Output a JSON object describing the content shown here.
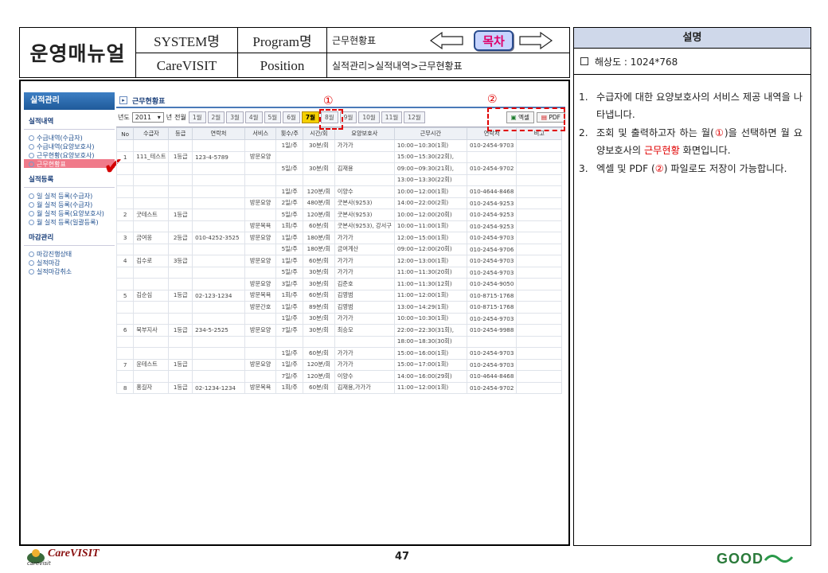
{
  "header": {
    "title": "운영매뉴얼",
    "system_label": "SYSTEM명",
    "system_value": "CareVISIT",
    "program_label": "Program명",
    "program_value": "근무현황표",
    "position_label": "Position",
    "position_value": "실적관리>실적내역>근무현황표",
    "toc_label": "목차"
  },
  "description": {
    "title": "설명",
    "resolution": "해상도 : 1024*768",
    "items": [
      {
        "num": "1.",
        "text": "수급자에 대한 요양보호사의 서비스 제공 내역을 나타냅니다."
      },
      {
        "num": "2.",
        "pre": "조회 및 출력하고자 하는 월(",
        "mark": "①",
        "mid": ")을 선택하면 월 요양보호사의 ",
        "red": "근무현황",
        "post": " 화면입니다."
      },
      {
        "num": "3.",
        "pre": "엑셀 및 PDF (",
        "mark": "②",
        "post": ") 파일로도 저장이 가능합니다."
      }
    ]
  },
  "app": {
    "nav_title": "실적관리",
    "sections": [
      {
        "title": "실적내역",
        "items": [
          "수급내역(수급자)",
          "수급내역(요양보호사)",
          "근무현황(요양보호사)",
          "근무현황표"
        ]
      },
      {
        "title": "실적등록",
        "items": [
          "일 실적 등록(수급자)",
          "월 실적 등록(수급자)",
          "월 실적 등록(요양보호사)",
          "월 실적 등록(일괄등록)"
        ]
      },
      {
        "title": "마감관리",
        "items": [
          "마감진행상태",
          "실적마감",
          "실적마감취소"
        ]
      }
    ],
    "page_title": "근무현황표",
    "year_label": "년도",
    "year_value": "2011",
    "year_suffix": "년",
    "all_months": "전월",
    "months": [
      "1월",
      "2월",
      "3월",
      "4월",
      "5월",
      "6월",
      "7월",
      "8월",
      "9월",
      "10월",
      "11월",
      "12월"
    ],
    "selected_month": "7월",
    "excel_label": "엑셀",
    "pdf_label": "PDF",
    "marker1": "①",
    "marker2": "②",
    "columns": [
      "No",
      "수급자",
      "등급",
      "연락처",
      "서비스",
      "횟수/주",
      "시간/회",
      "요양보호사",
      "근무시간",
      "연락처",
      "비고"
    ],
    "rows": [
      [
        "",
        "",
        "",
        "",
        "",
        "1일/주",
        "30분/회",
        "가가가",
        "10:00~10:30(1회)",
        "010-2454-9703",
        ""
      ],
      [
        "1",
        "111_테스트",
        "1등급",
        "123-4-5789",
        "방문요양",
        "",
        "",
        "",
        "15:00~15:30(22회),",
        "",
        ""
      ],
      [
        "",
        "",
        "",
        "",
        "",
        "5일/주",
        "30분/회",
        "김재용",
        "09:00~09:30(21회),",
        "010-2454-9702",
        ""
      ],
      [
        "",
        "",
        "",
        "",
        "",
        "",
        "",
        "",
        "13:00~13:30(22회)",
        "",
        ""
      ],
      [
        "",
        "",
        "",
        "",
        "",
        "1일/주",
        "120분/회",
        "이양수",
        "10:00~12:00(1회)",
        "010-4644-8468",
        ""
      ],
      [
        "",
        "",
        "",
        "",
        "방문요양",
        "2일/주",
        "480분/회",
        "굿본사(9253)",
        "14:00~22:00(2회)",
        "010-2454-9253",
        ""
      ],
      [
        "2",
        "굿테스트",
        "1등급",
        "",
        "",
        "5일/주",
        "120분/회",
        "굿본사(9253)",
        "10:00~12:00(20회)",
        "010-2454-9253",
        ""
      ],
      [
        "",
        "",
        "",
        "",
        "방문목욕",
        "1회/주",
        "60분/회",
        "굿본사(9253), 강서구",
        "10:00~11:00(1회)",
        "010-2454-9253",
        ""
      ],
      [
        "3",
        "금여옹",
        "2등급",
        "010-4252-3525",
        "방문요양",
        "1일/주",
        "180분/회",
        "가가가",
        "12:00~15:00(1회)",
        "010-2454-9703",
        ""
      ],
      [
        "",
        "",
        "",
        "",
        "",
        "5일/주",
        "180분/회",
        "금여계산",
        "09:00~12:00(20회)",
        "010-2454-9706",
        ""
      ],
      [
        "4",
        "김수로",
        "3등급",
        "",
        "방문요양",
        "1일/주",
        "60분/회",
        "가가가",
        "12:00~13:00(1회)",
        "010-2454-9703",
        ""
      ],
      [
        "",
        "",
        "",
        "",
        "",
        "5일/주",
        "30분/회",
        "가가가",
        "11:00~11:30(20회)",
        "010-2454-9703",
        ""
      ],
      [
        "",
        "",
        "",
        "",
        "방문요양",
        "3일/주",
        "30분/회",
        "김준호",
        "11:00~11:30(12회)",
        "010-2454-9050",
        ""
      ],
      [
        "5",
        "김순심",
        "1등급",
        "02-123-1234",
        "방문목욕",
        "1회/주",
        "60분/회",
        "김영범",
        "11:00~12:00(1회)",
        "010-8715-1768",
        ""
      ],
      [
        "",
        "",
        "",
        "",
        "방문간호",
        "1일/주",
        "89분/회",
        "김영범",
        "13:00~14:29(1회)",
        "010-8715-1768",
        ""
      ],
      [
        "",
        "",
        "",
        "",
        "",
        "1일/주",
        "30분/회",
        "가가가",
        "10:00~10:30(1회)",
        "010-2454-9703",
        ""
      ],
      [
        "6",
        "북부지사",
        "1등급",
        "234-5-2525",
        "방문요양",
        "7일/주",
        "30분/회",
        "최승모",
        "22:00~22:30(31회),",
        "010-2454-9988",
        ""
      ],
      [
        "",
        "",
        "",
        "",
        "",
        "",
        "",
        "",
        "18:00~18:30(30회)",
        "",
        ""
      ],
      [
        "",
        "",
        "",
        "",
        "",
        "1일/주",
        "60분/회",
        "가가가",
        "15:00~16:00(1회)",
        "010-2454-9703",
        ""
      ],
      [
        "7",
        "윤테스트",
        "1등급",
        "",
        "방문요양",
        "1일/주",
        "120분/회",
        "가가가",
        "15:00~17:00(1회)",
        "010-2454-9703",
        ""
      ],
      [
        "",
        "",
        "",
        "",
        "",
        "7일/주",
        "120분/회",
        "이양수",
        "14:00~16:00(29회)",
        "010-4644-8468",
        ""
      ],
      [
        "8",
        "홍길자",
        "1등급",
        "02-1234-1234",
        "방문목욕",
        "1회/주",
        "60분/회",
        "김재용,가가가",
        "11:00~12:00(1회)",
        "010-2454-9702",
        ""
      ]
    ]
  },
  "footer": {
    "logo_text": "CareVISIT",
    "logo_sub": "carevisit",
    "page_number": "47",
    "brand": "GOOD"
  },
  "colors": {
    "accent_red": "#e00000",
    "nav_blue": "#1f5a9a",
    "selected_month": "#f4d000",
    "toc_text": "#e0006a"
  }
}
